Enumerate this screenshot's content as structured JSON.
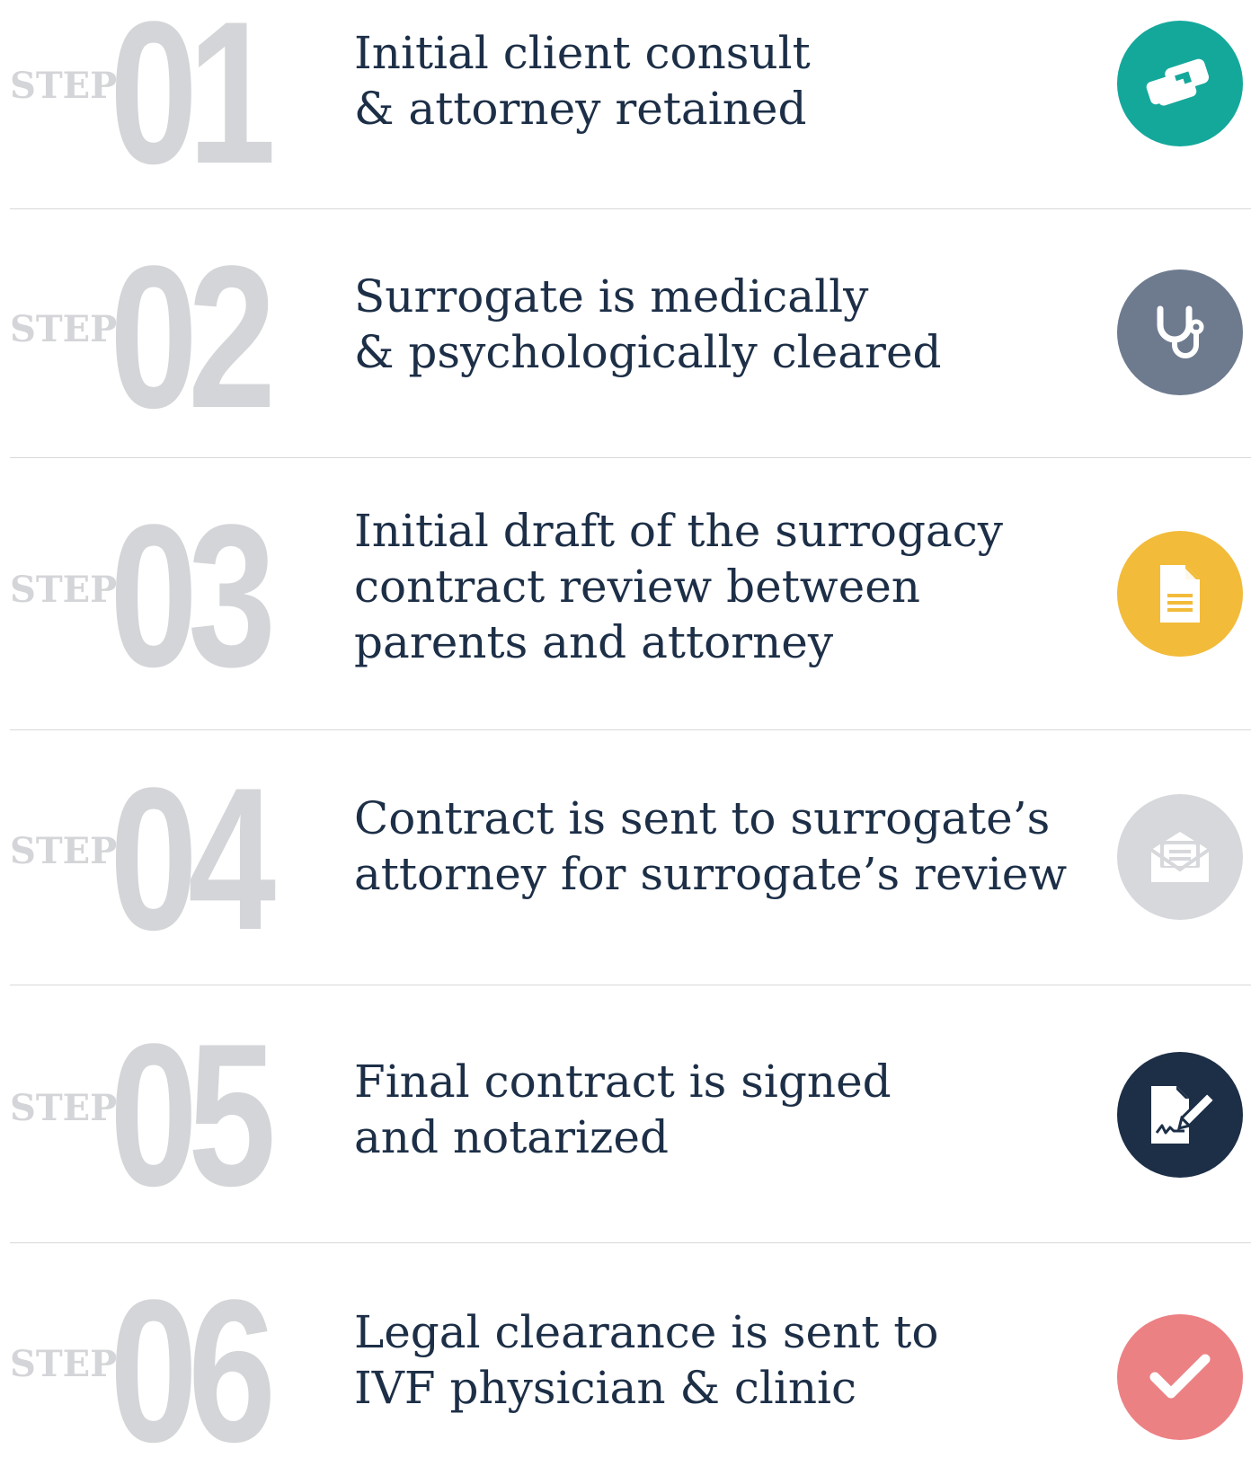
{
  "steps": [
    {
      "step_label": "STEP",
      "number": "01",
      "lines": [
        "Initial client consult",
        "& attorney retained"
      ],
      "icon": "handshake-icon",
      "color": "#14a89b"
    },
    {
      "step_label": "STEP",
      "number": "02",
      "lines": [
        "Surrogate is medically",
        "& psychologically cleared"
      ],
      "icon": "stethoscope-icon",
      "color": "#6e7b8f"
    },
    {
      "step_label": "STEP",
      "number": "03",
      "lines": [
        "Initial draft of the surrogacy",
        "contract review between",
        "parents and attorney"
      ],
      "icon": "document-icon",
      "color": "#f2bb3a"
    },
    {
      "step_label": "STEP",
      "number": "04",
      "lines": [
        "Contract is sent to surrogate’s",
        "attorney for surrogate’s review"
      ],
      "icon": "envelope-icon",
      "color": "#d7d8db"
    },
    {
      "step_label": "STEP",
      "number": "05",
      "lines": [
        "Final contract is signed",
        "and notarized"
      ],
      "icon": "sign-document-icon",
      "color": "#1d2f47"
    },
    {
      "step_label": "STEP",
      "number": "06",
      "lines": [
        "Legal clearance is sent to",
        "IVF physician & clinic"
      ],
      "icon": "checkmark-icon",
      "color": "#ec8184"
    }
  ]
}
